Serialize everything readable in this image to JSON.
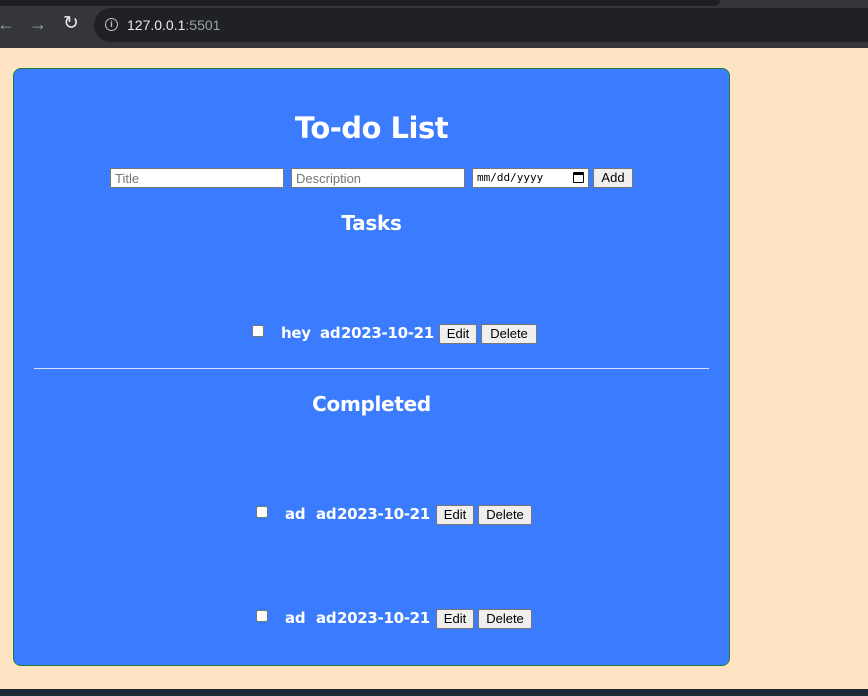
{
  "browser": {
    "url_host": "127.0.0.1",
    "url_port": ":5501"
  },
  "app": {
    "title": "To-do List",
    "form": {
      "title_placeholder": "Title",
      "description_placeholder": "Description",
      "date_placeholder": "mm/dd/yyyy",
      "add_label": "Add"
    },
    "tasks_heading": "Tasks",
    "tasks": [
      {
        "title": "hey",
        "description": "ad",
        "date": "2023-10-21",
        "completed": false,
        "edit_label": "Edit",
        "delete_label": "Delete"
      }
    ],
    "completed_heading": "Completed",
    "completed": [
      {
        "title": "ad",
        "description": "ad",
        "date": "2023-10-21",
        "completed": false,
        "edit_label": "Edit",
        "delete_label": "Delete"
      },
      {
        "title": "ad",
        "description": "ad",
        "date": "2023-10-21",
        "completed": false,
        "edit_label": "Edit",
        "delete_label": "Delete"
      }
    ]
  },
  "colors": {
    "page_background": "#ffe4c4",
    "card_background": "#3b7cff",
    "card_border": "#1b7f3a"
  }
}
